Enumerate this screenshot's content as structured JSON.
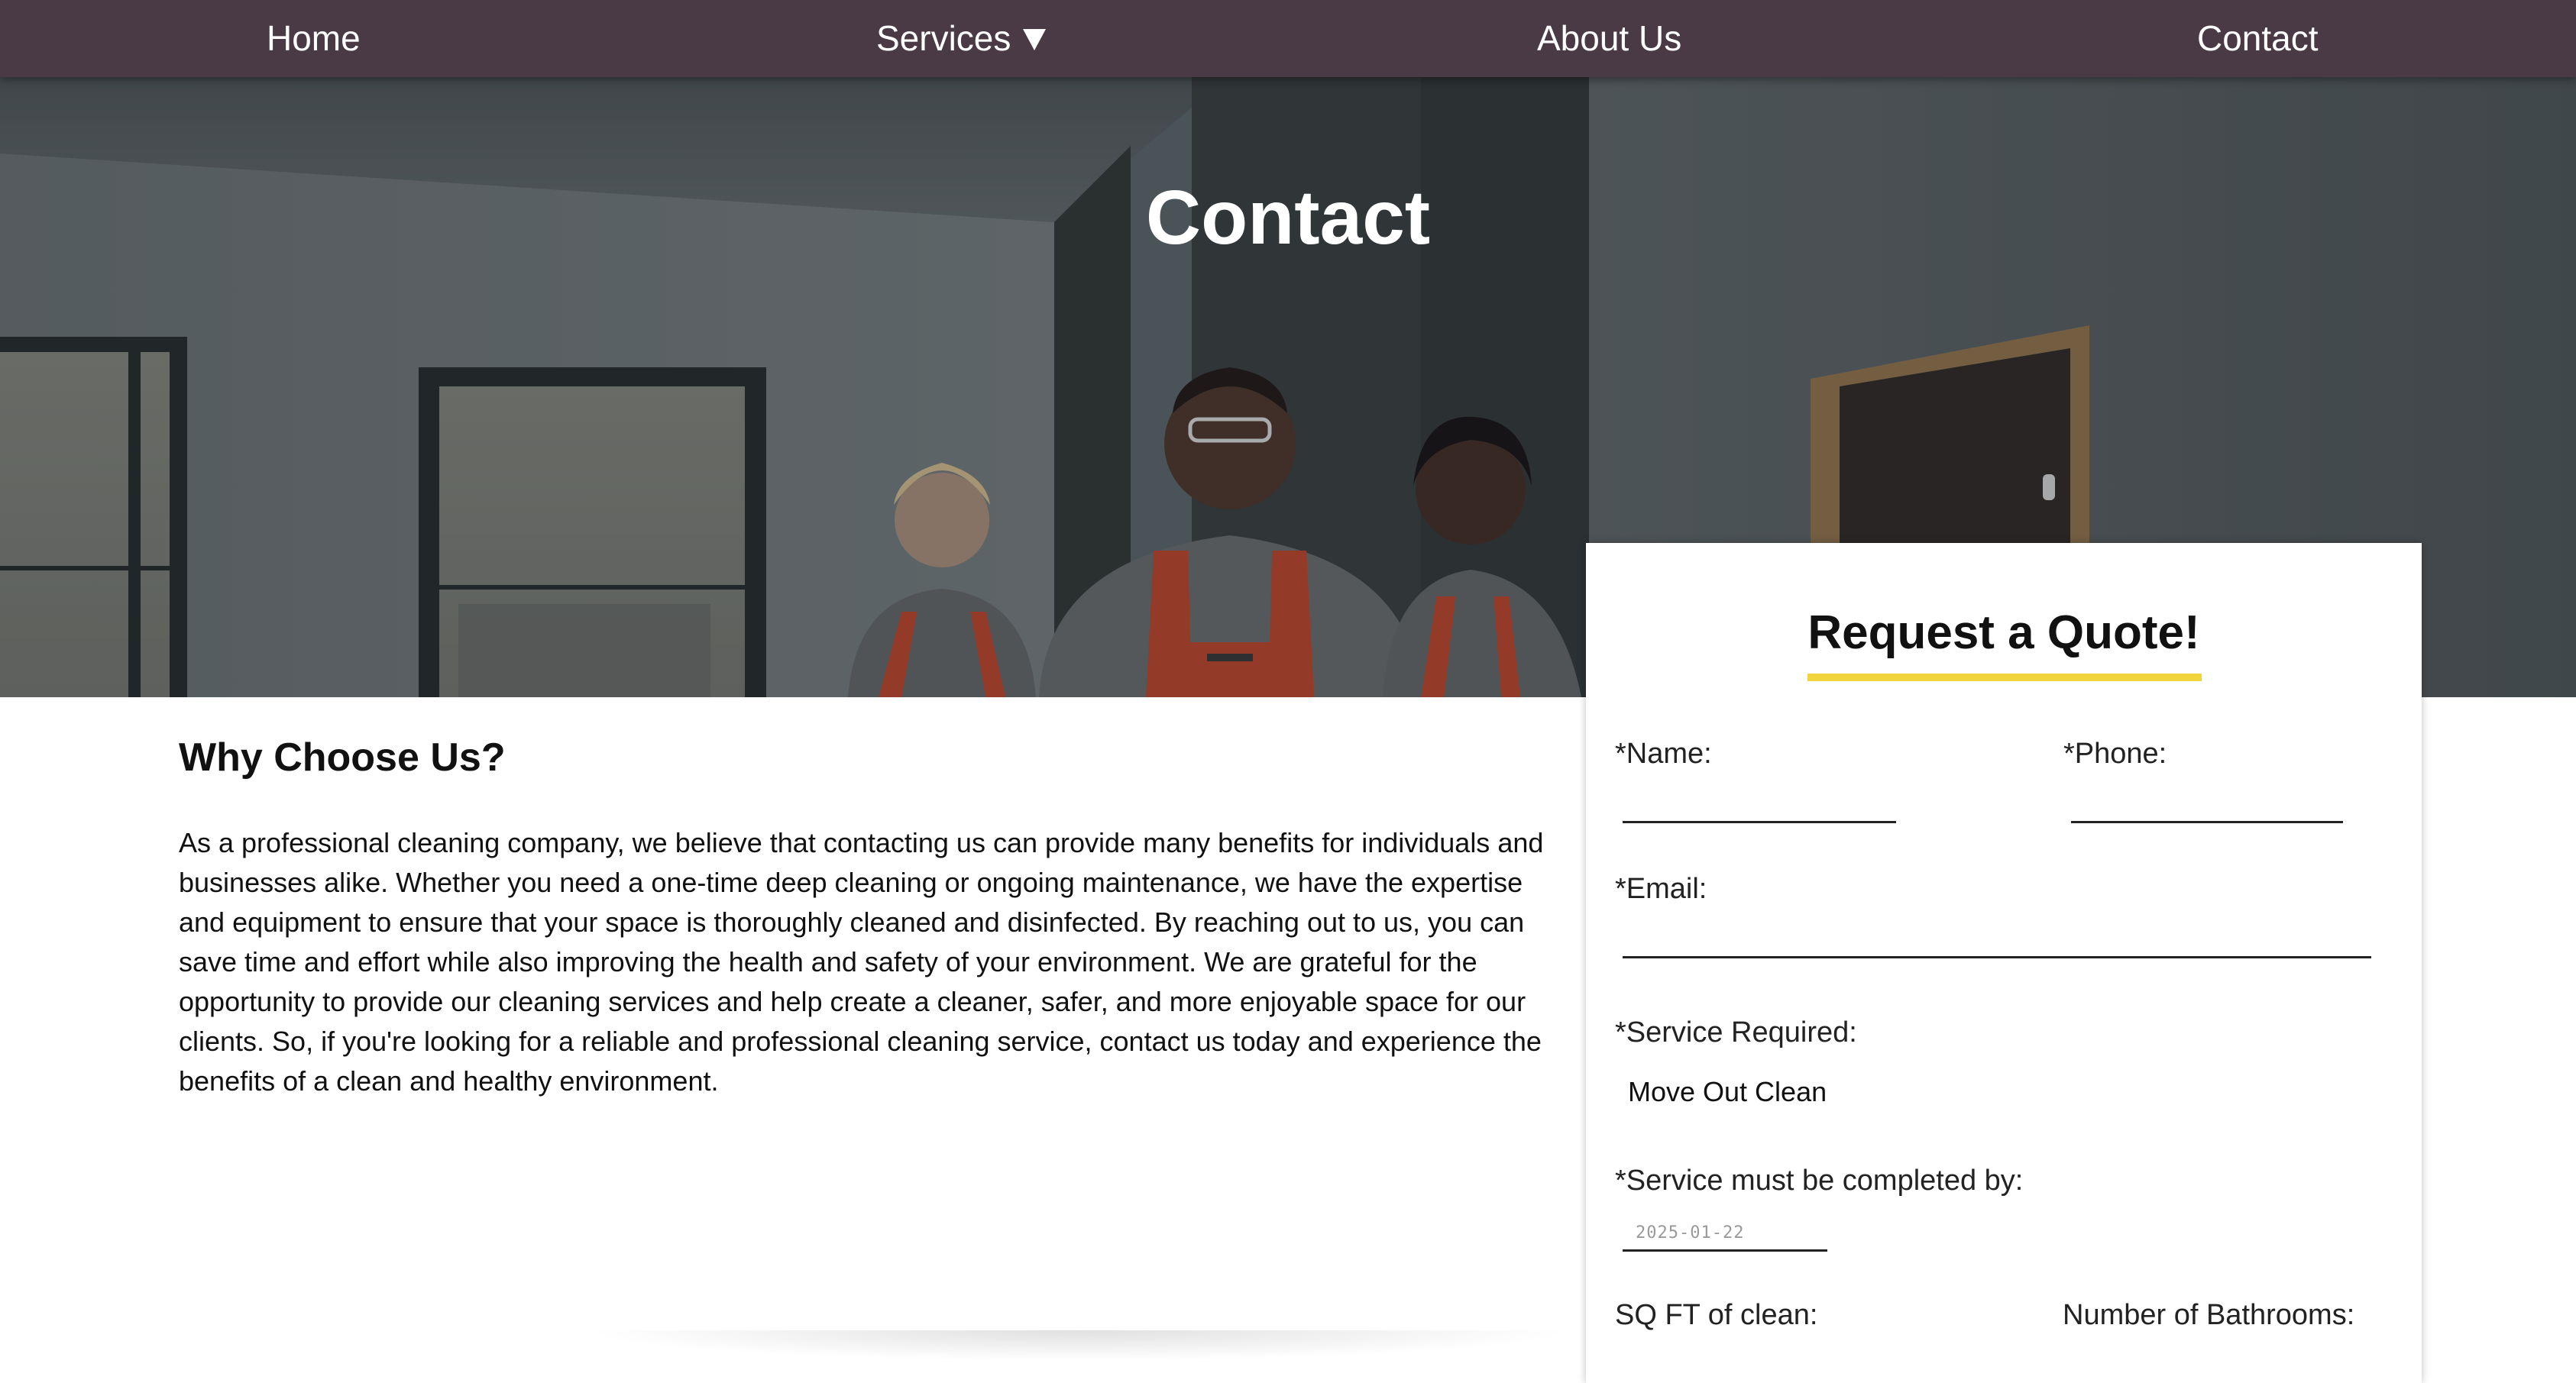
{
  "nav": {
    "home": "Home",
    "services": "Services",
    "about": "About Us",
    "contact": "Contact"
  },
  "hero": {
    "title": "Contact"
  },
  "why": {
    "title": "Why Choose Us?",
    "body": "As a professional cleaning company, we believe that contacting us can provide many benefits for individuals and businesses alike. Whether you need a one-time deep cleaning or ongoing maintenance, we have the expertise and equipment to ensure that your space is thoroughly cleaned and disinfected. By reaching out to us, you can save time and effort while also improving the health and safety of your environment. We are grateful for the opportunity to provide our cleaning services and help create a cleaner, safer, and more enjoyable space for our clients. So, if you're looking for a reliable and professional cleaning service, contact us today and experience the benefits of a clean and healthy environment."
  },
  "quote": {
    "title": "Request a Quote!",
    "name_label": "*Name:",
    "name_value": "",
    "phone_label": "*Phone:",
    "phone_value": "",
    "email_label": "*Email:",
    "email_value": "",
    "service_label": "*Service Required:",
    "service_value": "Move Out Clean",
    "date_label": "*Service must be completed by:",
    "date_value": "2025-01-22",
    "sqft_label": "SQ FT of clean:",
    "baths_label": "Number of Bathrooms:"
  },
  "colors": {
    "nav_bg": "#4a3a46",
    "accent_underline": "#f2d43d",
    "text": "#111111"
  }
}
